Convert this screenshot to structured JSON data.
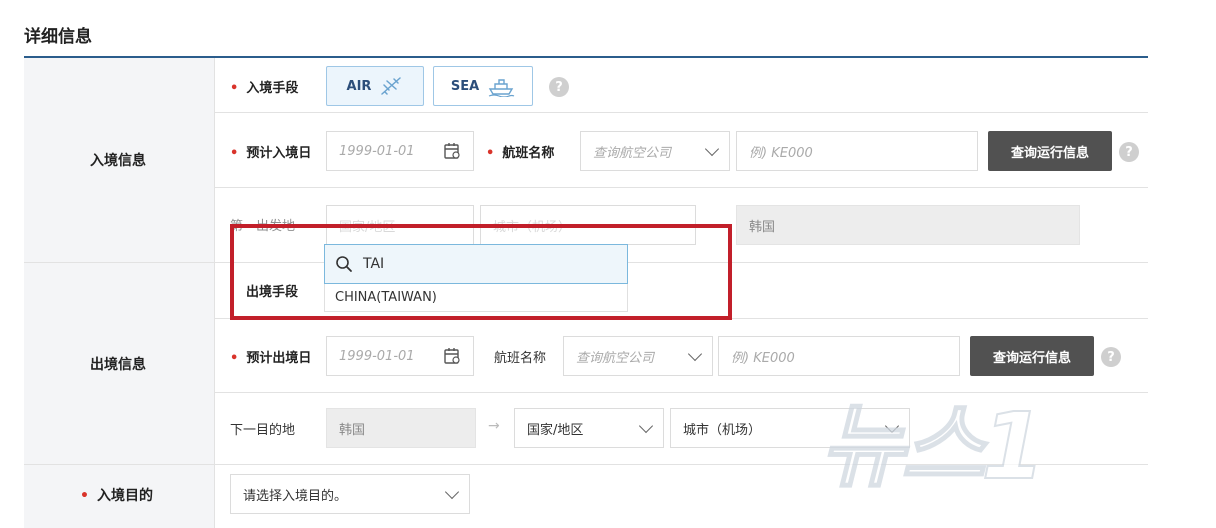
{
  "section": {
    "title": "详细信息"
  },
  "entry": {
    "group_label": "入境信息",
    "method_label": "入境手段",
    "air_label": "AIR",
    "sea_label": "SEA",
    "date_label": "预计入境日",
    "date_placeholder": "1999-01-01",
    "flight_label": "航班名称",
    "airline_placeholder": "查询航空公司",
    "flight_no_placeholder": "例) KE000",
    "query_button": "查询运行信息",
    "origin_label": "第一出发地",
    "country_placeholder": "国家/地区",
    "city_placeholder": "城市（机场）",
    "destination_value": "韩国"
  },
  "dropdown": {
    "search_value": "TAI",
    "option": "CHINA(TAIWAN)"
  },
  "exit": {
    "group_label": "出境信息",
    "method_label": "出境手段",
    "date_label": "预计出境日",
    "date_placeholder": "1999-01-01",
    "flight_label": "航班名称",
    "airline_placeholder": "查询航空公司",
    "flight_no_placeholder": "例) KE000",
    "query_button": "查询运行信息",
    "next_label": "下一目的地",
    "origin_value": "韩国",
    "country_placeholder": "国家/地区",
    "city_placeholder": "城市（机场）"
  },
  "purpose": {
    "label": "入境目的",
    "placeholder": "请选择入境目的。"
  },
  "watermark": {
    "text": "뉴스1"
  },
  "colors": {
    "accent_line": "#2b5d8c",
    "required": "#d9342b",
    "highlight_box": "#c21f2a",
    "toggle_border": "#9fc7e6",
    "button_dark": "#515151"
  }
}
